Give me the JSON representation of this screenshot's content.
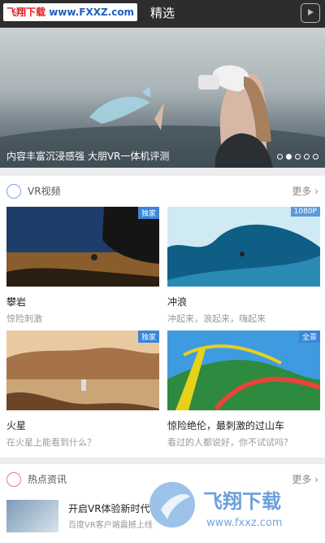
{
  "header": {
    "title": "精选",
    "watermark_part1": "飞翔下载",
    "watermark_part2": " www.FXXZ.com"
  },
  "banner": {
    "caption": "内容丰富沉浸感强 大朋VR一体机评测",
    "page_count": 5,
    "active_page": 2
  },
  "vr_video": {
    "title": "VR视频",
    "more_label": "更多",
    "cards": [
      {
        "title": "攀岩",
        "subtitle": "惊险刺激",
        "tag": "独家",
        "tag_color": "#3a86d8"
      },
      {
        "title": "冲浪",
        "subtitle": "冲起来，浪起来，嗨起来",
        "tag": "1080P",
        "tag_color": "#5a9ad8"
      },
      {
        "title": "火星",
        "subtitle": "在火星上能看到什么？",
        "tag": "独家",
        "tag_color": "#3a86d8"
      },
      {
        "title": "惊险绝伦，最刺激的过山车",
        "subtitle": "看过的人都说好，你不试试吗？",
        "tag": "全景",
        "tag_color": "#3a86d8"
      }
    ]
  },
  "hot_news": {
    "title": "热点资讯",
    "more_label": "更多",
    "items": [
      {
        "title": "开启VR体验新时代",
        "subtitle": "百度VR客户端震撼上线"
      }
    ]
  },
  "overlay_watermark": {
    "text": "飞翔下载",
    "url": "www.fxxz.com"
  }
}
